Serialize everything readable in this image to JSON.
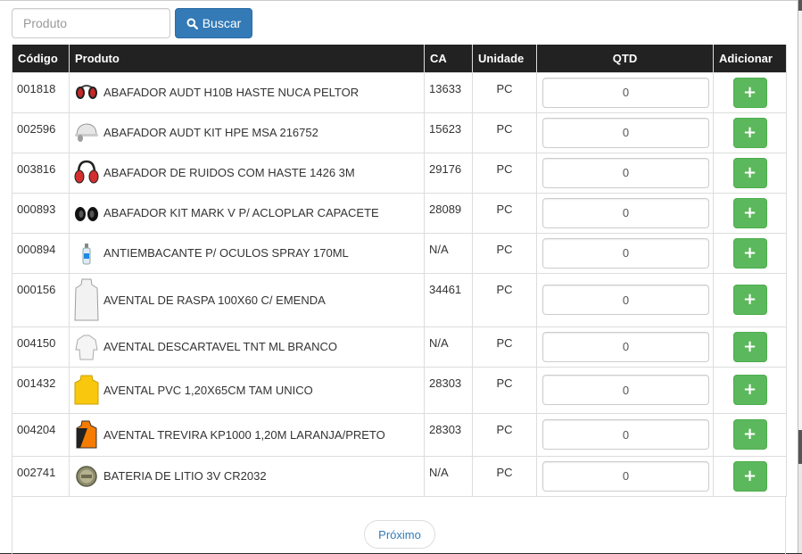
{
  "search": {
    "placeholder": "Produto",
    "button_label": "Buscar"
  },
  "table": {
    "headers": {
      "code": "Código",
      "product": "Produto",
      "ca": "CA",
      "unit": "Unidade",
      "qty": "QTD",
      "add": "Adicionar"
    },
    "rows": [
      {
        "code": "001818",
        "product": "ABAFADOR AUDT H10B HASTE NUCA PELTOR",
        "ca": "13633",
        "unit": "PC",
        "qty": "0",
        "add": "+",
        "thumb": "earmuff-icon"
      },
      {
        "code": "002596",
        "product": "ABAFADOR AUDT KIT HPE MSA 216752",
        "ca": "15623",
        "unit": "PC",
        "qty": "0",
        "add": "+",
        "thumb": "helmet-earmuff-icon"
      },
      {
        "code": "003816",
        "product": "ABAFADOR DE RUIDOS COM HASTE 1426 3M",
        "ca": "29176",
        "unit": "PC",
        "qty": "0",
        "add": "+",
        "thumb": "earmuff-headband-icon"
      },
      {
        "code": "000893",
        "product": "ABAFADOR KIT MARK V P/ ACLOPLAR CAPACETE",
        "ca": "28089",
        "unit": "PC",
        "qty": "0",
        "add": "+",
        "thumb": "earmuff-cups-icon"
      },
      {
        "code": "000894",
        "product": "ANTIEMBACANTE P/ OCULOS SPRAY 170ML",
        "ca": "N/A",
        "unit": "PC",
        "qty": "0",
        "add": "+",
        "thumb": "spray-bottle-icon"
      },
      {
        "code": "000156",
        "product": "AVENTAL DE RASPA 100X60 C/ EMENDA",
        "ca": "34461",
        "unit": "PC",
        "qty": "0",
        "add": "+",
        "thumb": "apron-white-icon"
      },
      {
        "code": "004150",
        "product": "AVENTAL DESCARTAVEL TNT ML BRANCO",
        "ca": "N/A",
        "unit": "PC",
        "qty": "0",
        "add": "+",
        "thumb": "gown-icon"
      },
      {
        "code": "001432",
        "product": "AVENTAL PVC 1,20X65CM TAM UNICO",
        "ca": "28303",
        "unit": "PC",
        "qty": "0",
        "add": "+",
        "thumb": "apron-yellow-icon"
      },
      {
        "code": "004204",
        "product": "AVENTAL TREVIRA KP1000 1,20M LARANJA/PRETO",
        "ca": "28303",
        "unit": "PC",
        "qty": "0",
        "add": "+",
        "thumb": "apron-orange-black-icon"
      },
      {
        "code": "002741",
        "product": "BATERIA DE LITIO 3V CR2032",
        "ca": "N/A",
        "unit": "PC",
        "qty": "0",
        "add": "+",
        "thumb": "coin-battery-icon"
      }
    ]
  },
  "pagination": {
    "next_label": "Próximo"
  },
  "colors": {
    "header_bg": "#222222",
    "primary": "#337ab7",
    "success": "#5cb85c",
    "border": "#dddddd"
  }
}
